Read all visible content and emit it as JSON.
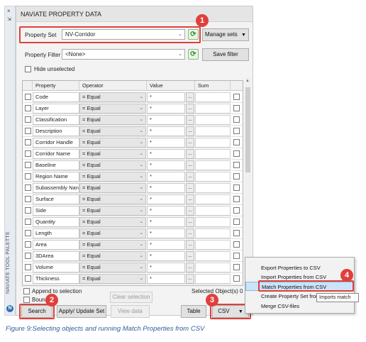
{
  "palette": {
    "vertical_label": "NAVIATE TOOL PALETTE",
    "close_glyph": "×",
    "pin_glyph": "⇲",
    "logo_letter": "N"
  },
  "window": {
    "title": "NAVIATE PROPERTY DATA"
  },
  "property_set": {
    "label": "Property Set",
    "value": "NV-Corridor",
    "manage_label": "Manage sets",
    "manage_arrow": "▼"
  },
  "property_filter": {
    "label": "Property Filter",
    "value": "<None>",
    "save_label": "Save filter"
  },
  "hide_unselected_label": "Hide unselected",
  "grid": {
    "headers": {
      "property": "Property",
      "operator": "Operator",
      "value": "Value",
      "sum": "Sum"
    },
    "rows": [
      {
        "property": "Code",
        "operator": "= Equal",
        "value": "*",
        "dots": "..."
      },
      {
        "property": "Layer",
        "operator": "= Equal",
        "value": "*",
        "dots": "..."
      },
      {
        "property": "Classification",
        "operator": "= Equal",
        "value": "*",
        "dots": "..."
      },
      {
        "property": "Description",
        "operator": "= Equal",
        "value": "*",
        "dots": "..."
      },
      {
        "property": "Corridor Handle",
        "operator": "= Equal",
        "value": "*",
        "dots": "..."
      },
      {
        "property": "Corridor Name",
        "operator": "= Equal",
        "value": "*",
        "dots": "..."
      },
      {
        "property": "Baseline",
        "operator": "= Equal",
        "value": "*",
        "dots": "..."
      },
      {
        "property": "Region Name",
        "operator": "= Equal",
        "value": "*",
        "dots": "..."
      },
      {
        "property": "Subassembly Nan",
        "operator": "= Equal",
        "value": "*",
        "dots": "..."
      },
      {
        "property": "Surface",
        "operator": "= Equal",
        "value": "*",
        "dots": "..."
      },
      {
        "property": "Side",
        "operator": "= Equal",
        "value": "*",
        "dots": "..."
      },
      {
        "property": "Quantity",
        "operator": "= Equal",
        "value": "*",
        "dots": "..."
      },
      {
        "property": "Length",
        "operator": "= Equal",
        "value": "*",
        "dots": "..."
      },
      {
        "property": "Area",
        "operator": "= Equal",
        "value": "*",
        "dots": "..."
      },
      {
        "property": "3DArea",
        "operator": "= Equal",
        "value": "*",
        "dots": "..."
      },
      {
        "property": "Volume",
        "operator": "= Equal",
        "value": "*",
        "dots": "..."
      },
      {
        "property": "Thickness",
        "operator": "= Equal",
        "value": "*",
        "dots": "..."
      }
    ]
  },
  "bottom": {
    "append_label": "Append to selection",
    "bound_label": "Bound",
    "clear_label": "Clear selection",
    "selected_label": "Selected Object(s)",
    "selected_count": "0",
    "search_label": "Search",
    "apply_label": "Apply/ Update Set",
    "view_label": "View data",
    "table_label": "Table",
    "csv_label": "CSV",
    "csv_arrow": "▼"
  },
  "csv_menu": {
    "items": [
      "Export Properties to CSV",
      "Import Properties from CSV",
      "Match Properties from CSV",
      "Create Property Set from",
      "Merge CSV-files"
    ],
    "tooltip": "Imports match"
  },
  "badges": [
    "1",
    "2",
    "3",
    "4"
  ],
  "caption": "Figure 9:Selecting objects and running Match Properties from CSV",
  "colors": {
    "callout_red": "#e0403c",
    "highlight": "#cde3f7",
    "caption_blue": "#2f5e9c"
  }
}
